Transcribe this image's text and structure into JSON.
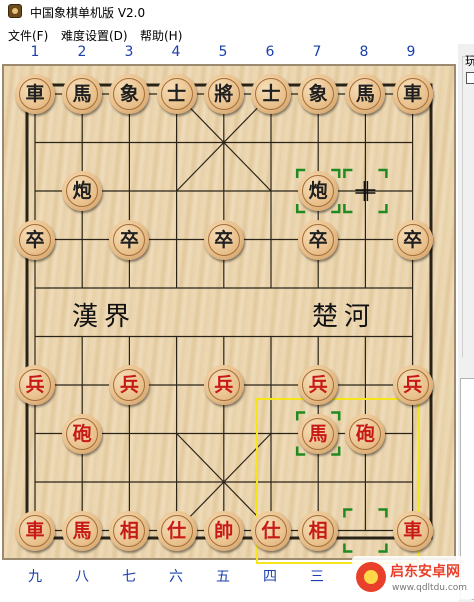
{
  "window": {
    "title": "中国象棋单机版 V2.0"
  },
  "menu": [
    {
      "label": "文件(F)"
    },
    {
      "label": "难度设置(D)"
    },
    {
      "label": "帮助(H)"
    }
  ],
  "board": {
    "top_numbers": [
      "1",
      "2",
      "3",
      "4",
      "5",
      "6",
      "7",
      "8",
      "9"
    ],
    "bottom_numbers": [
      "九",
      "八",
      "七",
      "六",
      "五",
      "四",
      "三"
    ],
    "river_left": "漢界",
    "river_right": "楚河",
    "pieces": [
      {
        "label": "車",
        "side": "black",
        "col": 0,
        "row": 0
      },
      {
        "label": "馬",
        "side": "black",
        "col": 1,
        "row": 0
      },
      {
        "label": "象",
        "side": "black",
        "col": 2,
        "row": 0
      },
      {
        "label": "士",
        "side": "black",
        "col": 3,
        "row": 0
      },
      {
        "label": "將",
        "side": "black",
        "col": 4,
        "row": 0
      },
      {
        "label": "士",
        "side": "black",
        "col": 5,
        "row": 0
      },
      {
        "label": "象",
        "side": "black",
        "col": 6,
        "row": 0
      },
      {
        "label": "馬",
        "side": "black",
        "col": 7,
        "row": 0
      },
      {
        "label": "車",
        "side": "black",
        "col": 8,
        "row": 0
      },
      {
        "label": "炮",
        "side": "black",
        "col": 1,
        "row": 2
      },
      {
        "label": "炮",
        "side": "black",
        "col": 6,
        "row": 2
      },
      {
        "label": "卒",
        "side": "black",
        "col": 0,
        "row": 3
      },
      {
        "label": "卒",
        "side": "black",
        "col": 2,
        "row": 3
      },
      {
        "label": "卒",
        "side": "black",
        "col": 4,
        "row": 3
      },
      {
        "label": "卒",
        "side": "black",
        "col": 6,
        "row": 3
      },
      {
        "label": "卒",
        "side": "black",
        "col": 8,
        "row": 3
      },
      {
        "label": "兵",
        "side": "red",
        "col": 0,
        "row": 6
      },
      {
        "label": "兵",
        "side": "red",
        "col": 2,
        "row": 6
      },
      {
        "label": "兵",
        "side": "red",
        "col": 4,
        "row": 6
      },
      {
        "label": "兵",
        "side": "red",
        "col": 6,
        "row": 6
      },
      {
        "label": "兵",
        "side": "red",
        "col": 8,
        "row": 6
      },
      {
        "label": "砲",
        "side": "red",
        "col": 1,
        "row": 7
      },
      {
        "label": "馬",
        "side": "red",
        "col": 6,
        "row": 7
      },
      {
        "label": "砲",
        "side": "red",
        "col": 7,
        "row": 7
      },
      {
        "label": "車",
        "side": "red",
        "col": 0,
        "row": 9
      },
      {
        "label": "馬",
        "side": "red",
        "col": 1,
        "row": 9
      },
      {
        "label": "相",
        "side": "red",
        "col": 2,
        "row": 9
      },
      {
        "label": "仕",
        "side": "red",
        "col": 3,
        "row": 9
      },
      {
        "label": "帥",
        "side": "red",
        "col": 4,
        "row": 9
      },
      {
        "label": "仕",
        "side": "red",
        "col": 5,
        "row": 9
      },
      {
        "label": "相",
        "side": "red",
        "col": 6,
        "row": 9
      },
      {
        "label": "車",
        "side": "red",
        "col": 8,
        "row": 9
      }
    ],
    "selection_markers": [
      {
        "col": 6,
        "row": 2
      },
      {
        "col": 7,
        "row": 2
      },
      {
        "col": 6,
        "row": 7
      },
      {
        "col": 7,
        "row": 9
      }
    ],
    "highlight_color": "#f5e61a",
    "marker_color": "#1f8a1f"
  },
  "side_panel": {
    "label": "玩"
  },
  "watermark": {
    "title": "启东安卓网",
    "url": "www.qdltdu.com"
  },
  "colors": {
    "red_piece": "#c81a14",
    "black_piece": "#202020",
    "coordinates": "#1a3fae"
  }
}
